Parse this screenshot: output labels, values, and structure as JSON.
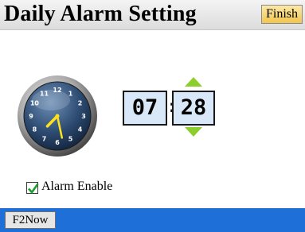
{
  "header": {
    "title": "Daily Alarm Setting",
    "finish_label": "Finish"
  },
  "clock": {
    "numerals": [
      "12",
      "1",
      "2",
      "3",
      "4",
      "5",
      "6",
      "7",
      "8",
      "9",
      "10",
      "11"
    ],
    "hour": 7,
    "minute": 28
  },
  "time": {
    "hour": "07",
    "separator": ":",
    "minute": "28"
  },
  "alarm": {
    "enable_label": "Alarm Enable",
    "enabled": true
  },
  "footer": {
    "f2now_label": "F2Now"
  },
  "colors": {
    "arrow_green": "#8ccf2c",
    "bottom_bar": "#1f6fd8",
    "time_box": "#d8e8f8",
    "check_green": "#1e9e2e"
  }
}
